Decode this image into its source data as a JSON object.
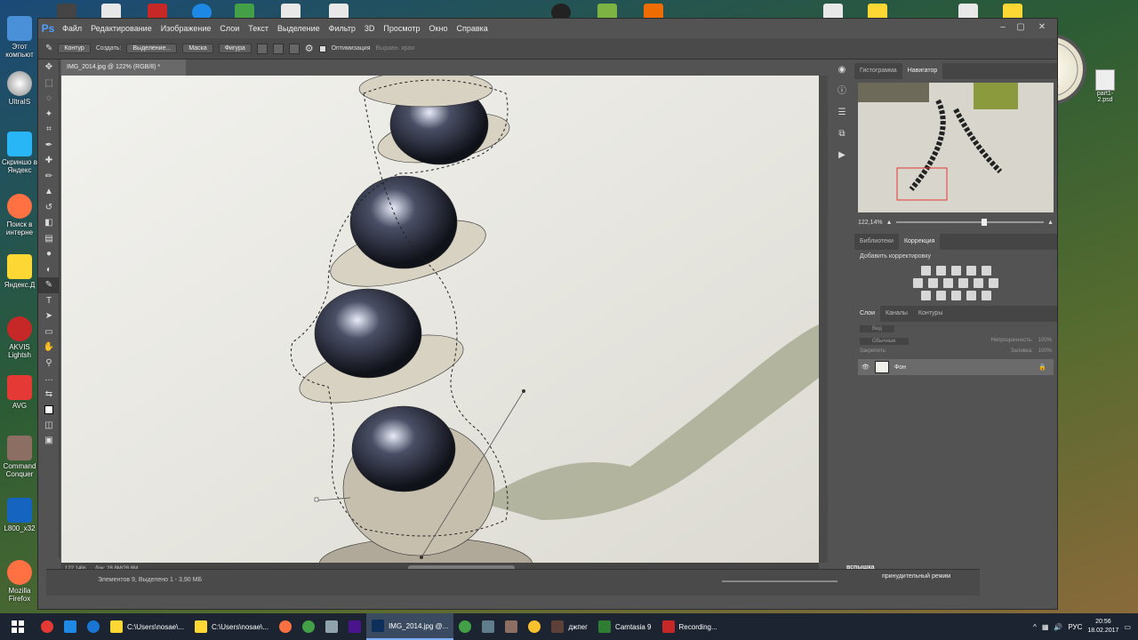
{
  "desktop": {
    "icons": [
      {
        "label": "Этот компьют"
      },
      {
        "label": "UltraIS"
      },
      {
        "label": "Скриншо в Яндекс"
      },
      {
        "label": "Поиск в интерне"
      },
      {
        "label": "Яндекс.Д"
      },
      {
        "label": "AKVIS Lightsh"
      },
      {
        "label": "AVG"
      },
      {
        "label": "Command Conquer"
      },
      {
        "label": "L800_x32"
      },
      {
        "label": "Mozilla Firefox"
      }
    ],
    "right_file": "part1-2.psd"
  },
  "photoshop": {
    "logo": "Ps",
    "menu": [
      "Файл",
      "Редактирование",
      "Изображение",
      "Слои",
      "Текст",
      "Выделение",
      "Фильтр",
      "3D",
      "Просмотр",
      "Окно",
      "Справка"
    ],
    "options": {
      "mode": "Контур",
      "make_label": "Создать:",
      "selection_btn": "Выделение...",
      "mask_btn": "Маска",
      "shape_btn": "Фигура",
      "optimize": "Оптимизация",
      "align_edges": "Выравн. края"
    },
    "doc_tab": "IMG_2014.jpg @ 122% (RGB/8) *",
    "status": {
      "zoom": "122,14%",
      "doc": "Док: 28,8M/28,8M"
    },
    "bottom_status": "Элементов 9, Выделено 1 - 3,90 МБ",
    "panels": {
      "top_tabs": [
        "Гистограмма",
        "Навигатор"
      ],
      "nav_zoom": "122,14%",
      "mid_tabs": [
        "Библиотеки",
        "Коррекция"
      ],
      "adjust_label": "Добавить корректировку",
      "layer_tabs": [
        "Слои",
        "Каналы",
        "Контуры"
      ],
      "layer_filter": "Вид",
      "blend_mode": "Обычные",
      "opacity_label": "Непрозрачность:",
      "opacity_value": "100%",
      "lock_label": "Закрепить:",
      "fill_label": "Заливка:",
      "fill_value": "100%",
      "layer_name": "Фон"
    }
  },
  "overlay_text": "принудительный режим",
  "overlay_text2": "вспышка",
  "taskbar": {
    "items": [
      {
        "label": "C:\\Users\\nosae\\..."
      },
      {
        "label": "C:\\Users\\nosae\\..."
      },
      {
        "label": "IMG_2014.jpg @..."
      },
      {
        "label": "джпег"
      },
      {
        "label": "Camtasia 9"
      },
      {
        "label": "Recording..."
      }
    ],
    "lang": "РУС",
    "time": "20:56",
    "date": "18.02.2017"
  },
  "colors": {
    "ps_bg": "#535353",
    "accent": "#4ea0ff"
  }
}
